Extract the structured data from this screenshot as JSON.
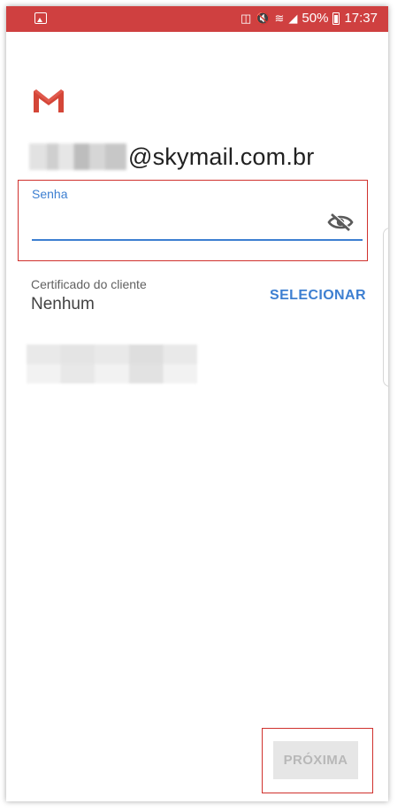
{
  "statusbar": {
    "battery_percent": "50%",
    "time": "17:37"
  },
  "account": {
    "email_domain": "@skymail.com.br"
  },
  "password": {
    "label": "Senha",
    "value": ""
  },
  "certificate": {
    "label": "Certificado do cliente",
    "value": "Nenhum",
    "select_label": "SELECIONAR"
  },
  "footer": {
    "next_label": "PRÓXIMA"
  },
  "colors": {
    "status_bar": "#cf4040",
    "accent": "#3d7fd1",
    "highlight": "#d0312d"
  },
  "icons": [
    "image-icon",
    "battery-saver-icon",
    "mute-icon",
    "wifi-icon",
    "signal-icon",
    "battery-icon",
    "gmail-logo-icon",
    "visibility-off-icon"
  ]
}
